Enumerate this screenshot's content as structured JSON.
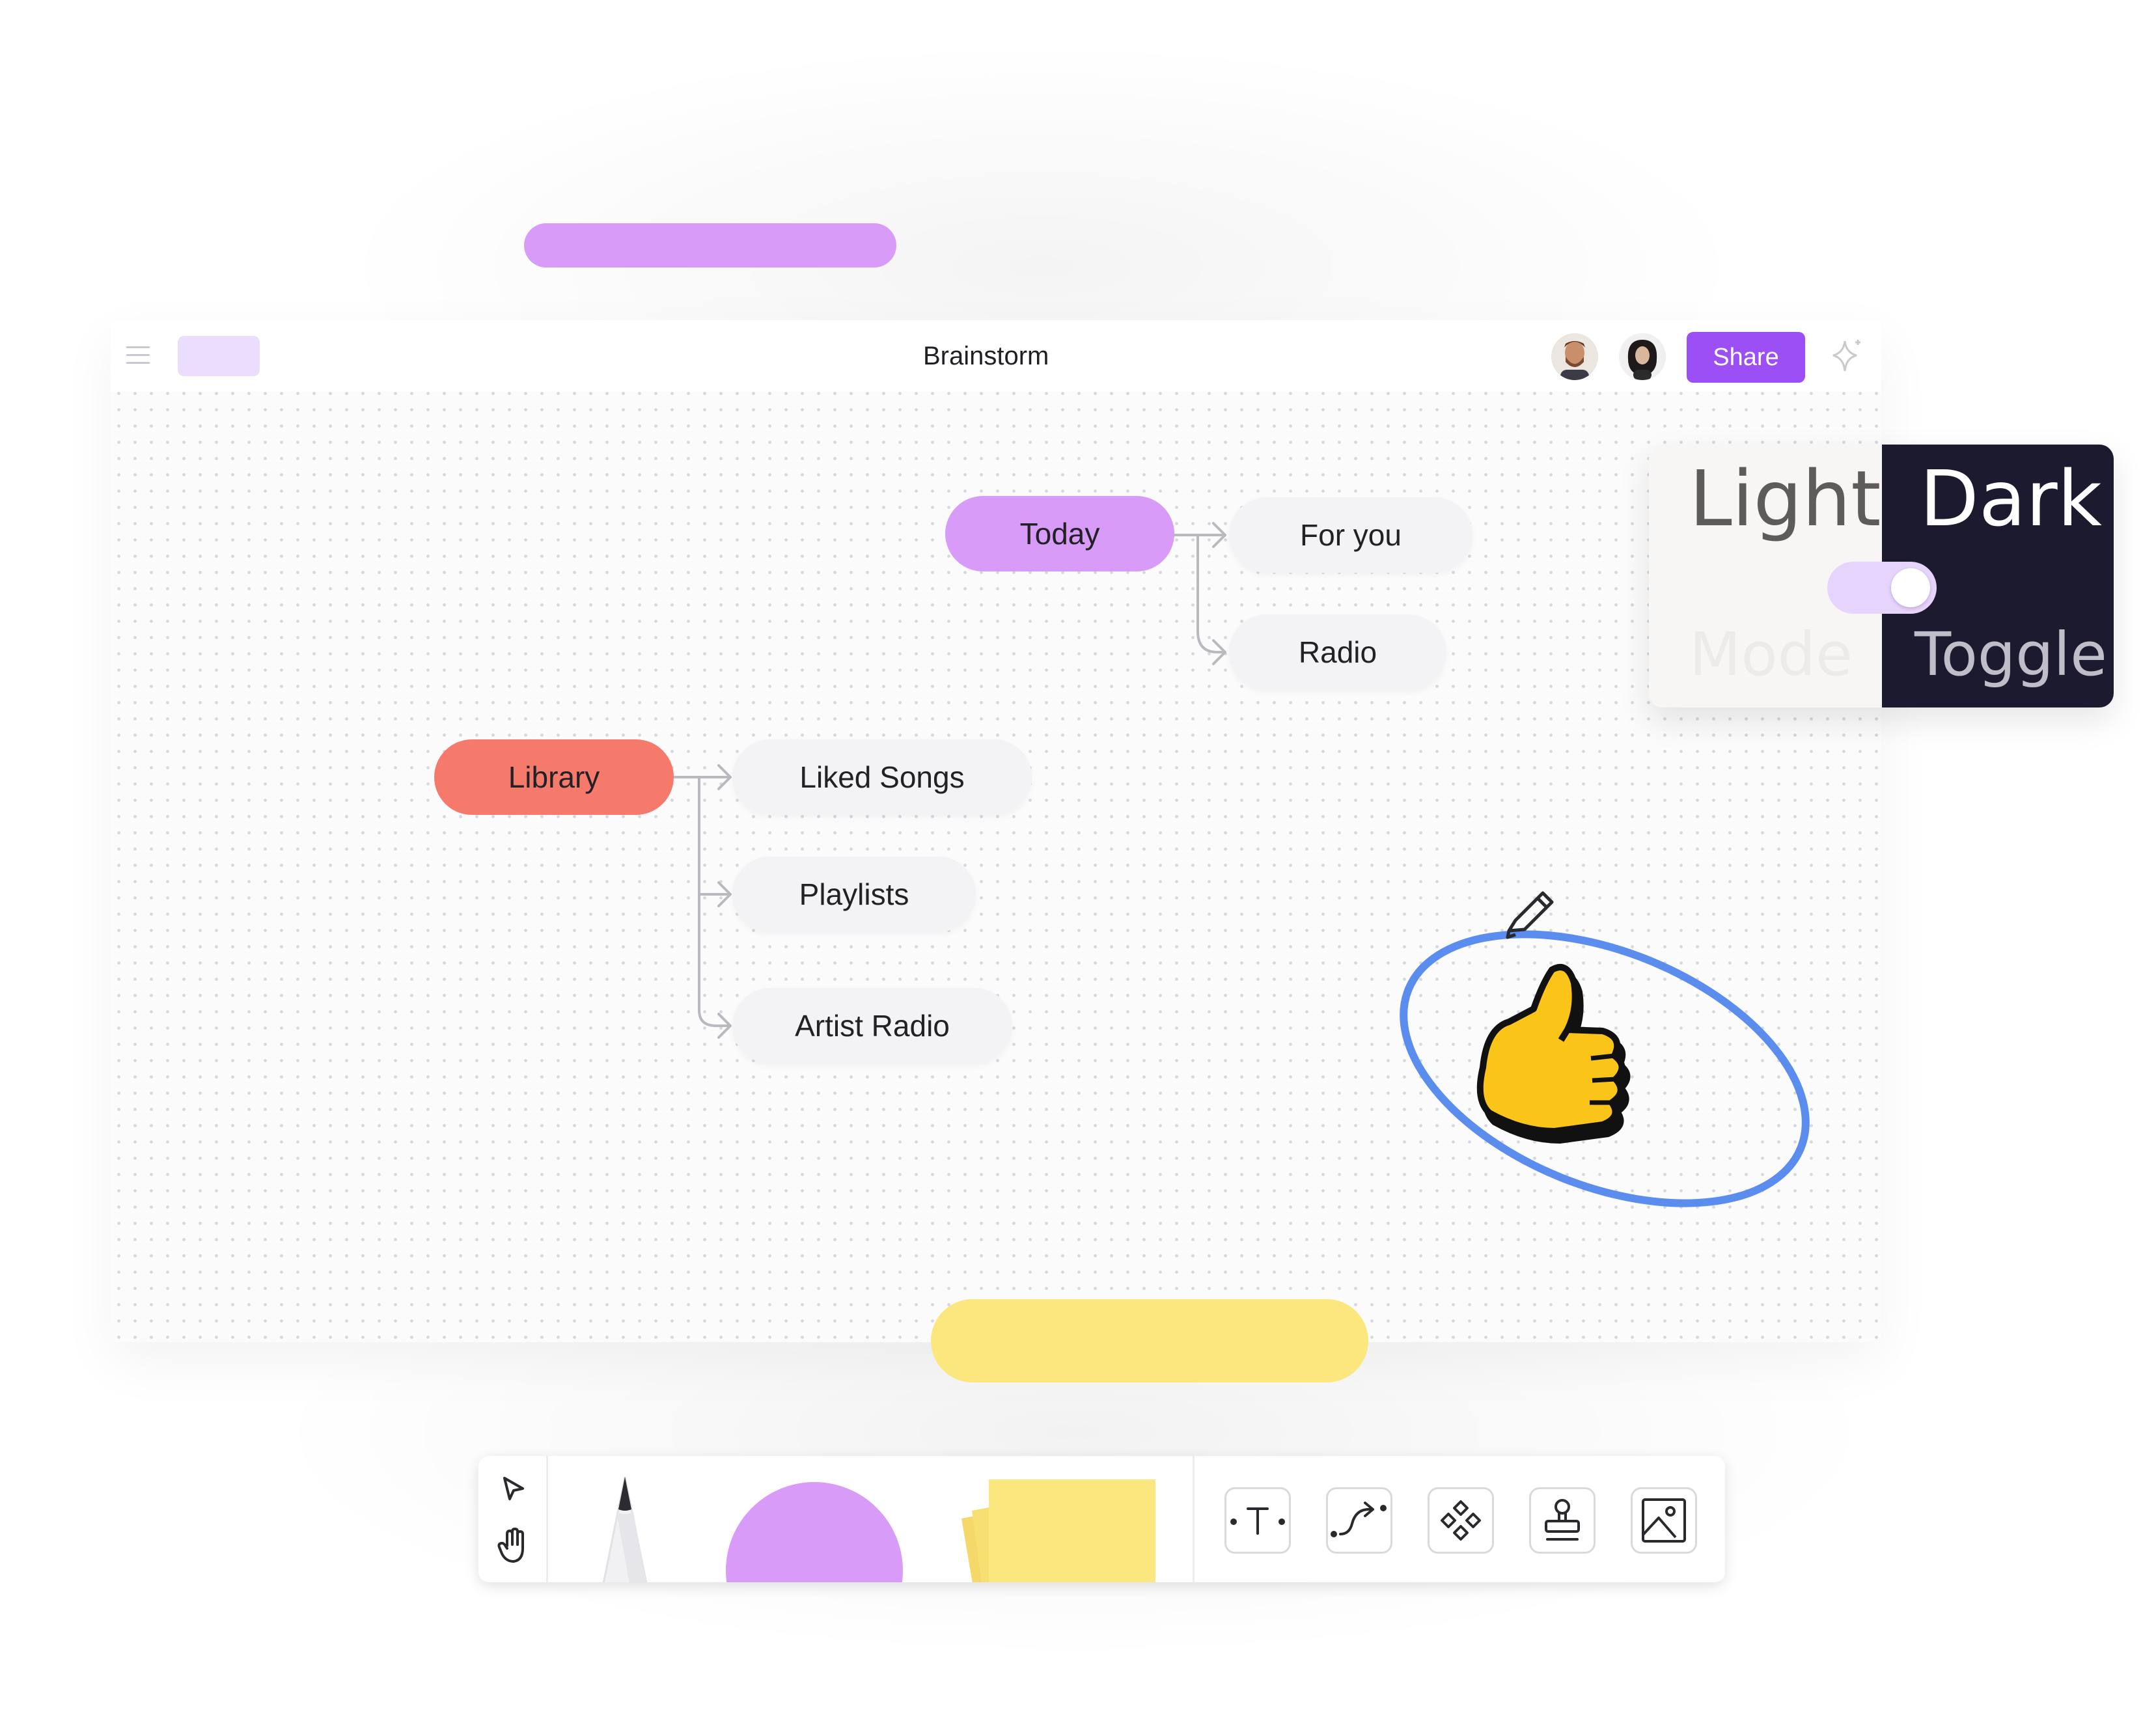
{
  "app": {
    "title": "Brainstorm",
    "share_label": "Share"
  },
  "mindmap": {
    "roots": [
      {
        "label": "Today",
        "color": "#d89cf8",
        "children": [
          "For you",
          "Radio"
        ]
      },
      {
        "label": "Library",
        "color": "#f57a6c",
        "children": [
          "Liked Songs",
          "Playlists",
          "Artist Radio"
        ]
      }
    ]
  },
  "theme_toggle": {
    "light_label": "Light",
    "dark_label": "Dark",
    "mode_label": "Mode",
    "toggle_label": "Toggle",
    "state": "dark"
  },
  "toolbar": {
    "tools": [
      "select-tool",
      "hand-tool",
      "pen-tool",
      "shape-tool",
      "sticky-note-tool",
      "text-tool",
      "connector-tool",
      "component-tool",
      "stamp-tool",
      "image-tool"
    ]
  },
  "colors": {
    "accent": "#9b4ff5",
    "purple": "#d89cf8",
    "coral": "#f57a6c",
    "yellow": "#fbe77e",
    "dark": "#1c1a2e",
    "annotation_blue": "#5b8def"
  }
}
